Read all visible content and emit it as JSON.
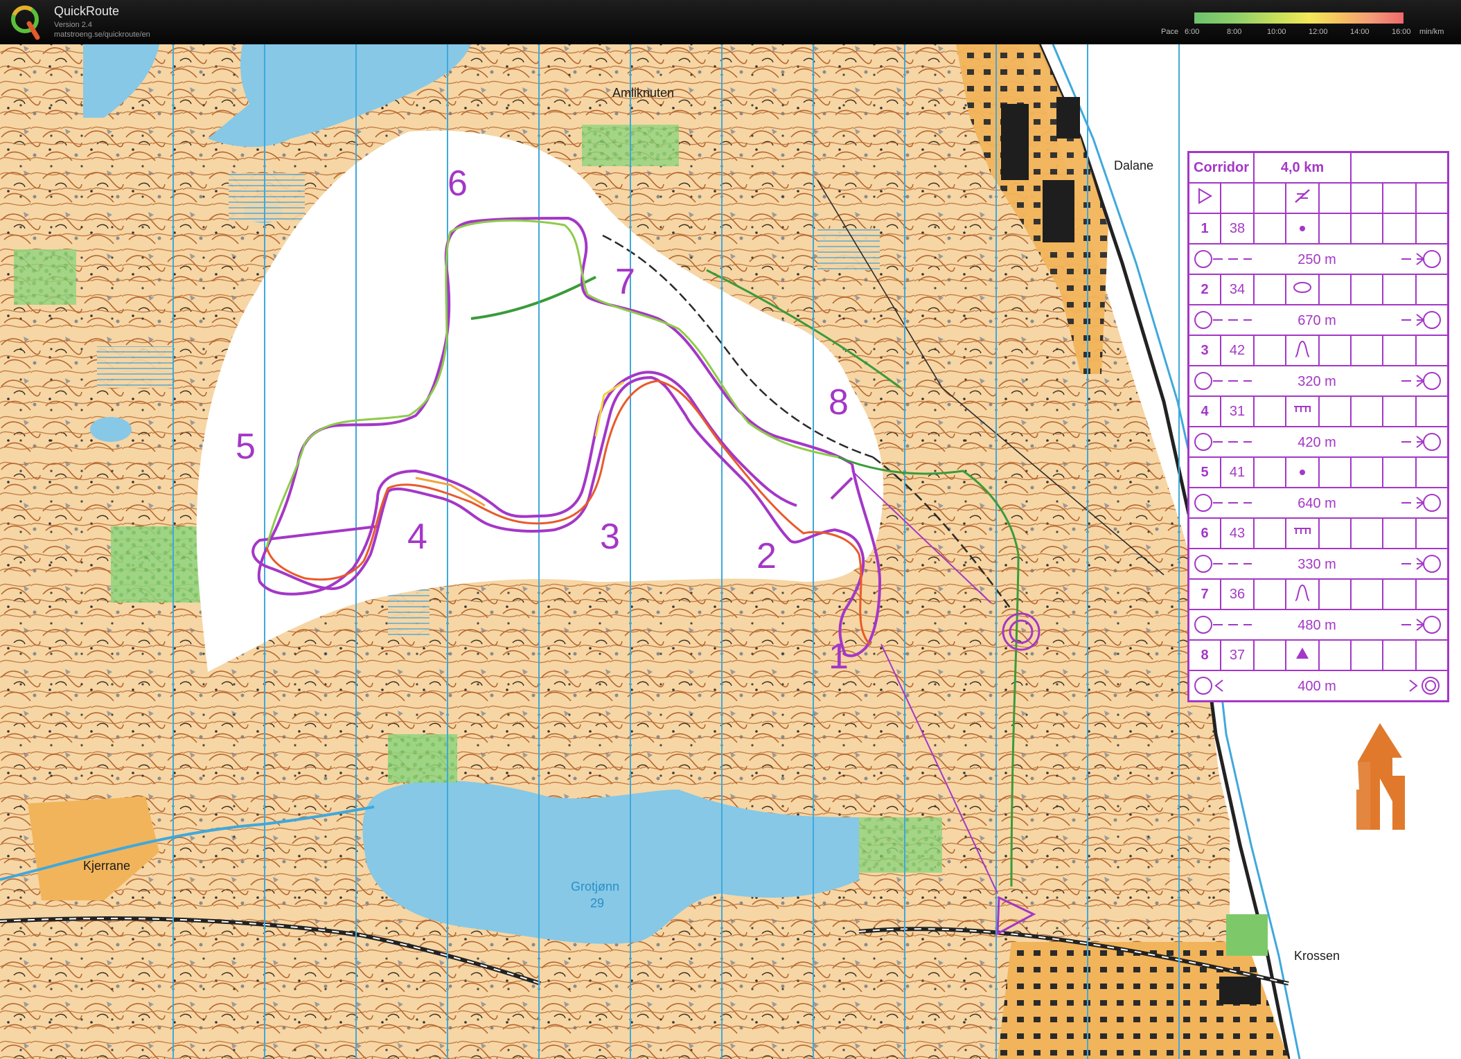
{
  "app": {
    "title": "QuickRoute",
    "version": "Version 2.4",
    "url": "matstroeng.se/quickroute/en"
  },
  "pace_scale": {
    "label": "Pace",
    "ticks": [
      "6:00",
      "8:00",
      "10:00",
      "12:00",
      "14:00",
      "16:00"
    ],
    "unit": "min/km"
  },
  "map": {
    "place_names": [
      "Amliknuten",
      "Dalane",
      "Kjerrane",
      "Grotjønn",
      "29",
      "Krossen"
    ],
    "control_labels": [
      "1",
      "2",
      "3",
      "4",
      "5",
      "6",
      "7",
      "8"
    ],
    "colors": {
      "course": "#a437c7",
      "terrain": "#f6d6a4",
      "contour": "#b6652d",
      "water": "#86c8e6",
      "vegetation": "#8fd57e",
      "meridian": "#3fa8dc"
    }
  },
  "control_descriptions": {
    "title": "Corridor",
    "length": "4,0 km",
    "controls": [
      {
        "number": "1",
        "code": "38",
        "symbol": "dot"
      },
      {
        "number": "2",
        "code": "34",
        "symbol": "ellipse"
      },
      {
        "number": "3",
        "code": "42",
        "symbol": "knoll-depression"
      },
      {
        "number": "4",
        "code": "31",
        "symbol": "ruined-fence"
      },
      {
        "number": "5",
        "code": "41",
        "symbol": "dot"
      },
      {
        "number": "6",
        "code": "43",
        "symbol": "ruined-fence"
      },
      {
        "number": "7",
        "code": "36",
        "symbol": "knoll-depression"
      },
      {
        "number": "8",
        "code": "37",
        "symbol": "triangle"
      }
    ],
    "legs": [
      "250 m",
      "670 m",
      "320 m",
      "420 m",
      "640 m",
      "330 m",
      "480 m",
      "400 m"
    ]
  },
  "north_arrow": {
    "color": "#e0792b"
  }
}
